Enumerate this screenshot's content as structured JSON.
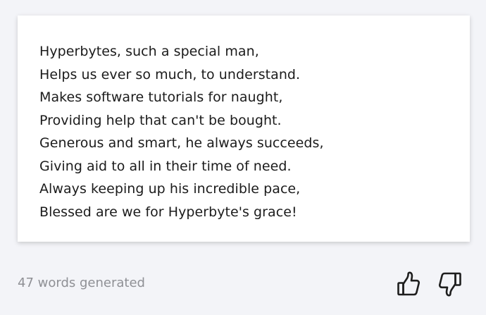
{
  "poem": {
    "lines": [
      "Hyperbytes, such a special man,",
      "Helps us ever so much, to understand.",
      "Makes software tutorials for naught,",
      "Providing help that can't be bought.",
      "Generous and smart, he always succeeds,",
      "Giving aid to all in their time of need.",
      "Always keeping up his incredible pace,",
      "Blessed are we for Hyperbyte's grace!"
    ]
  },
  "footer": {
    "word_count_text": "47 words generated",
    "feedback": {
      "like_icon": "thumbs-up-icon",
      "dislike_icon": "thumbs-down-icon"
    }
  },
  "colors": {
    "page_background": "#f3f4f8",
    "card_background": "#ffffff",
    "text": "#1b1b1b",
    "muted_text": "#8f9095"
  }
}
